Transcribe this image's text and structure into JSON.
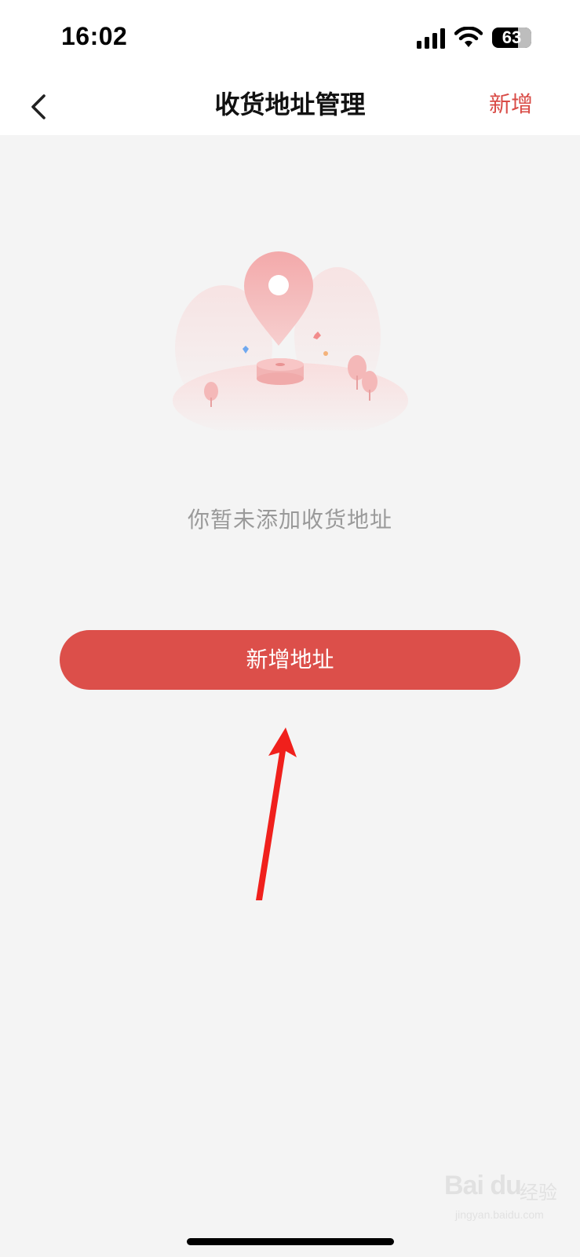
{
  "status_bar": {
    "time": "16:02",
    "battery_level": "63",
    "icons": [
      "signal-icon",
      "wifi-icon",
      "battery-icon"
    ]
  },
  "nav": {
    "back_icon": "chevron-left-icon",
    "title": "收货地址管理",
    "action_label": "新增",
    "action_color": "#d94b46"
  },
  "empty_state": {
    "illustration": "location-pin-icon",
    "message": "你暂未添加收货地址"
  },
  "primary_button": {
    "label": "新增地址",
    "color": "#dc4f4a"
  },
  "annotation": {
    "icon": "red-arrow-icon",
    "color": "#f0201c"
  },
  "watermark": {
    "logo_text": "Bai du",
    "brand": "经验",
    "url": "jingyan.baidu.com"
  },
  "colors": {
    "background": "#f4f4f4",
    "bar_background": "#ffffff",
    "message_text": "#9a9a9a"
  }
}
